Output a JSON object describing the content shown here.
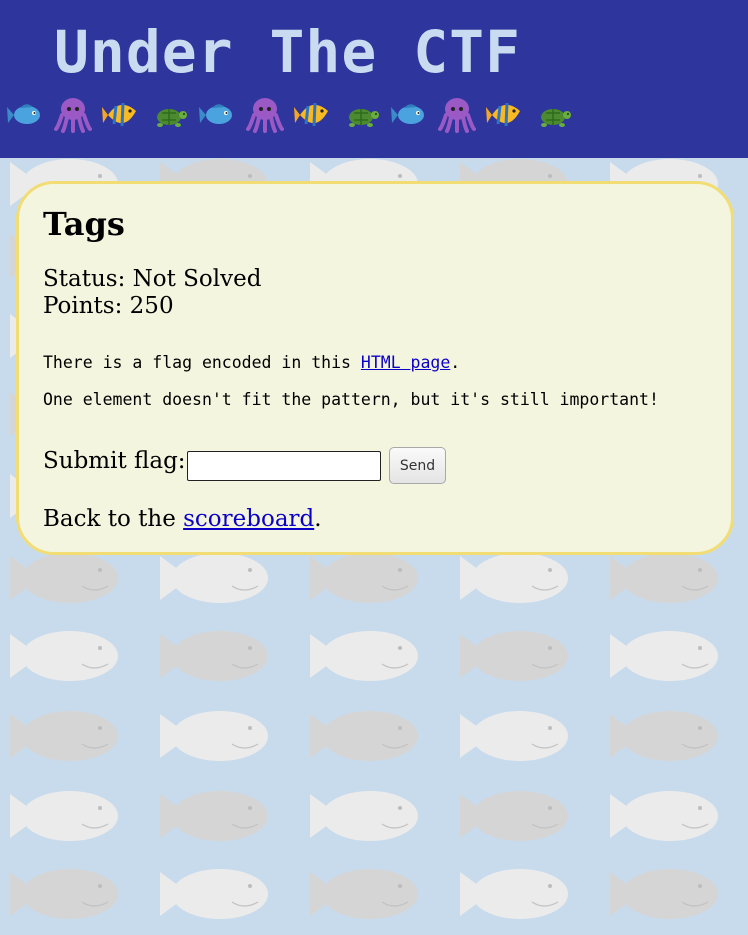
{
  "header": {
    "title": "Under The CTF",
    "emoji_sequence": [
      "fish",
      "octopus",
      "tropical-fish",
      "turtle",
      "fish",
      "octopus",
      "tropical-fish",
      "turtle",
      "fish",
      "octopus",
      "tropical-fish",
      "turtle"
    ]
  },
  "background": {
    "pattern_icon": "fish",
    "color": "#c8dbec"
  },
  "challenge": {
    "title": "Tags",
    "status_label": "Status:",
    "status_value": "Not Solved",
    "points_label": "Points:",
    "points_value": "250",
    "description_prefix": "There is a flag encoded in this ",
    "description_link": "HTML page",
    "description_suffix": ".",
    "hint": "One element doesn't fit the pattern, but it's still important!"
  },
  "form": {
    "submit_label": "Submit flag:",
    "input_value": "",
    "send_label": "Send"
  },
  "footer": {
    "back_prefix": "Back to the ",
    "back_link": "scoreboard",
    "back_suffix": "."
  },
  "colors": {
    "header_bg": "#2e359c",
    "title_color": "#c8dbf0",
    "card_bg": "#f4f5de",
    "card_border": "#f1dd73",
    "link": "#0b00c8"
  }
}
